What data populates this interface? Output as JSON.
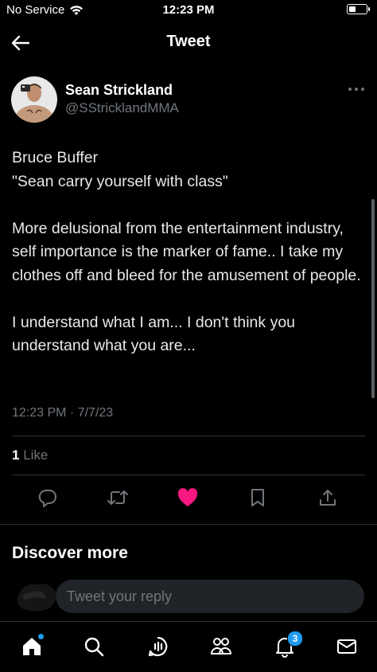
{
  "status_bar": {
    "carrier": "No Service",
    "time": "12:23 PM",
    "battery_level": 0.4
  },
  "nav": {
    "title": "Tweet"
  },
  "tweet": {
    "author_name": "Sean Strickland",
    "author_handle": "@SStricklandMMA",
    "paragraphs": [
      "Bruce Buffer\n\"Sean carry yourself with class\"",
      "More delusional from the entertainment industry, self importance is the marker of fame.. I take my clothes off and bleed for the amusement of people.",
      "I understand what I am... I don't think you understand what you are..."
    ],
    "timestamp": "12:23 PM · 7/7/23",
    "likes_count": "1",
    "likes_label": "Like",
    "liked": true
  },
  "actions": {
    "icons": [
      "reply-icon",
      "retweet-icon",
      "like-icon",
      "bookmark-icon",
      "share-icon"
    ]
  },
  "discover": {
    "title": "Discover more"
  },
  "reply": {
    "placeholder": "Tweet your reply"
  },
  "tab_bar": {
    "tabs": [
      "home",
      "search",
      "spaces",
      "communities",
      "notifications",
      "messages"
    ],
    "notification_count": "3"
  },
  "colors": {
    "background": "#000000",
    "text": "#e7e9ea",
    "secondary_text": "#71767b",
    "accent": "#1d9bf0",
    "like": "#f91880",
    "divider": "#2f3336"
  }
}
